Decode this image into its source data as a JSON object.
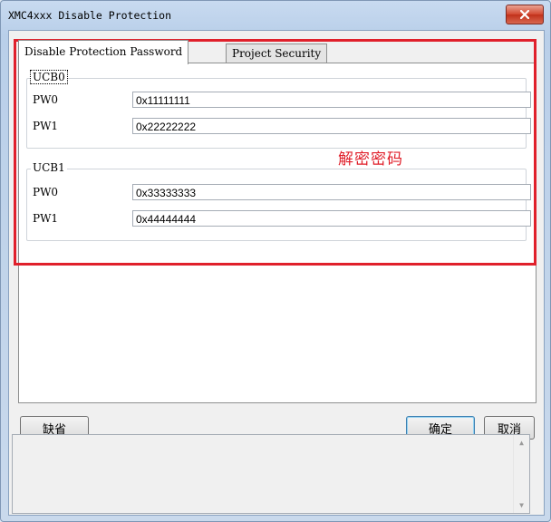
{
  "window": {
    "title": "XMC4xxx Disable Protection",
    "close_icon": "close-x-icon"
  },
  "tabs": [
    {
      "label": "Disable Protection Password",
      "active": true
    },
    {
      "label": "Project Security",
      "active": false
    }
  ],
  "groups": [
    {
      "legend": "UCB0",
      "fields": [
        {
          "label": "PW0",
          "value": "0x11111111"
        },
        {
          "label": "PW1",
          "value": "0x22222222"
        }
      ]
    },
    {
      "legend": "UCB1",
      "fields": [
        {
          "label": "PW0",
          "value": "0x33333333"
        },
        {
          "label": "PW1",
          "value": "0x44444444"
        }
      ]
    }
  ],
  "annotation": {
    "text": "解密密码",
    "color": "#e0202b"
  },
  "buttons": {
    "default_label": "缺省",
    "ok_label": "确定",
    "cancel_label": "取消"
  },
  "message_area": {
    "text": ""
  }
}
